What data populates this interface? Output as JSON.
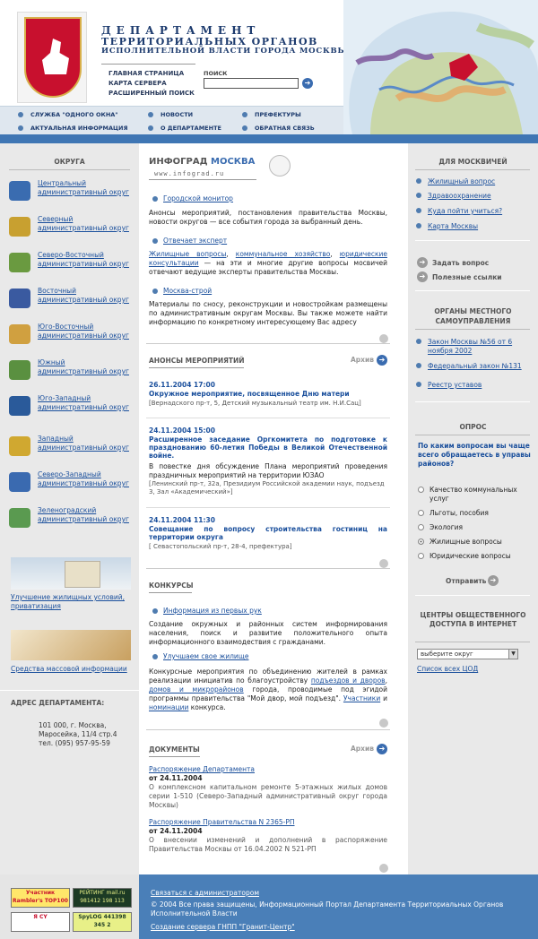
{
  "header": {
    "title_line1": "ДЕПАРТАМЕНТ",
    "title_line2": "ТЕРРИТОРИАЛЬНЫХ  ОРГАНОВ",
    "title_line3": "ИСПОЛНИТЕЛЬНОЙ ВЛАСТИ ГОРОДА МОСКВЫ",
    "links": [
      "ГЛАВНАЯ СТРАНИЦА",
      "КАРТА СЕРВЕРА",
      "РАСШИРЕННЫЙ ПОИСК"
    ],
    "search_label": "ПОИСК",
    "search_value": ""
  },
  "nav": {
    "items": [
      "СЛУЖБА \"ОДНОГО ОКНА\"",
      "НОВОСТИ",
      "ПРЕФЕКТУРЫ",
      "АКТУАЛЬНАЯ ИНФОРМАЦИЯ",
      "О ДЕПАРТАМЕНТЕ",
      "ОБРАТНАЯ СВЯЗЬ"
    ]
  },
  "left": {
    "heading": "ОКРУГА",
    "districts": [
      "Центральный административный округ",
      "Северный административный округ",
      "Северо-Восточный административный округ",
      "Восточный административный округ",
      "Юго-Восточный административный округ",
      "Южный административный округ",
      "Юго-Западный административный округ",
      "Западный административный округ",
      "Северо-Западный административный округ",
      "Зеленоградский административный округ"
    ],
    "promo1": "Улучшение жилищных условий, приватизация",
    "promo2": "Средства массовой информации",
    "address_heading": "АДРЕС ДЕПАРТАМЕНТА:",
    "address": [
      "101 000, г. Москва,",
      "Маросейка, 11/4 стр.4",
      "тел.  (095) 957-95-59"
    ]
  },
  "main": {
    "infograd_brand": "ИНФОГРАД",
    "infograd_city": "МОСКВА",
    "infograd_url": "www.infograd.ru",
    "monitor_link": "Городской монитор",
    "monitor_text": "Анонсы мероприятий, постановления правительства Москвы, новости округов — все события города за выбранный день.",
    "expert_link": "Отвечает эксперт",
    "expert_links": [
      "Жилищные вопросы",
      "коммунальное хозяйство",
      "юридические консультации"
    ],
    "expert_text": " — на эти и многие другие вопросы мосвичей отвечают ведущие эксперты правительства Москвы.",
    "build_link": "Москва-строй",
    "build_text": "Материалы по сносу, реконструкции и новостройкам размещены по административным округам Москвы. Вы также можете найти информацию по конкретному интересующему Вас адресу",
    "events_heading": "АНОНСЫ МЕРОПРИЯТИЙ",
    "archive": "Архив",
    "events": [
      {
        "date": "26.11.2004 17:00",
        "title": "Окружное мероприятие, посвященное Дню матери",
        "desc": "",
        "place": "[Вернадского пр-т, 5, Детский музыкальный театр им. Н.И.Сац]"
      },
      {
        "date": "24.11.2004 15:00",
        "title": "Расширенное заседание Оргкомитета по подготовке к празднованию 60-летия Победы в Великой Отечественной войне.",
        "desc": "В повестке дня обсуждение Плана мероприятий проведения праздничных мероприятий на территории ЮЗАО",
        "place": "[Ленинский пр-т, 32а, Президиум Российской академии наук, подъезд 3, Зал «Академический»]"
      },
      {
        "date": "24.11.2004 11:30",
        "title": "Совещание по вопросу строительства гостиниц на территории округа",
        "desc": "",
        "place": "[ Севастопольский пр-т, 28-4, префектура]"
      }
    ],
    "contests_heading": "КОНКУРСЫ",
    "contest1_link": "Информация из первых рук",
    "contest1_text": "Создание окружных и районных систем информирования населения, поиск и развитие положительного опыта информационного взаимодествия с гражданами.",
    "contest2_link": "Улучшаем свое жилище",
    "contest2_text_a": "Конкурсные мероприятия по объединению жителей в рамках реализации инициатив по благоустройству ",
    "contest2_link_a": "подъездов и дворов",
    "contest2_text_b": ", ",
    "contest2_link_b": "домов и микрорайонов",
    "contest2_text_c": " города, проводимые под эгидой программы правительства \"Мой двор, мой подъезд\". ",
    "contest2_link_c": "Участники",
    "contest2_text_d": " и ",
    "contest2_link_d": "номинации",
    "contest2_text_e": " конкурса.",
    "docs_heading": "ДОКУМЕНТЫ",
    "docs": [
      {
        "title": "Распоряжение Департамента",
        "date": "от 24.11.2004",
        "text": "О комплексном капитальном ремонте 5-этажных жилых домов серии 1-510 (Северо-Западный административный округ города Москвы)"
      },
      {
        "title": "Распоряжение Правительства N 2365-РП",
        "date": "от 24.11.2004",
        "text": "О внесении изменений и дополнений в распоряжение Правительства Москвы от 16.04.2002 N 521-РП"
      }
    ]
  },
  "right": {
    "heading1": "ДЛЯ МОСКВИЧЕЙ",
    "links1": [
      "Жилищный вопрос",
      "Здравоохранение",
      "Куда пойти учиться?",
      "Карта Москвы"
    ],
    "ask": "Задать  вопрос",
    "useful": "Полезные ссылки",
    "heading2": "ОРГАНЫ МЕСТНОГО САМОУПРАВЛЕНИЯ",
    "links2": [
      "Закон Москвы №56 от 6 ноября 2002",
      "Федеральный закон №131",
      "Реестр уставов"
    ],
    "poll_heading": "ОПРОС",
    "poll_question": "По каким вопросам вы чаще всего обращаетесь в управы районов?",
    "poll_options": [
      "Качество коммунальных услуг",
      "Льготы, пособия",
      "Экология",
      "Жилищные вопросы",
      "Юридические вопросы"
    ],
    "poll_selected": 3,
    "send": "Отправить",
    "access_heading": "ЦЕНТРЫ ОБЩЕСТВЕННОГО ДОСТУПА В ИНТЕРНЕТ",
    "select_value": "выберите округ",
    "cod_link": "Список всех ЦОД"
  },
  "footer": {
    "contact": "Связаться с администратором",
    "copyright": "© 2004 Все права защищены, Информационный Портал Департамента Территориальных Органов Исполнительной Власти",
    "created": "Создание сервера ГНПП \"Гранит-Центр\"",
    "badges": [
      "Участник Rambler's TOP100",
      "РЕЙТИНГ mail.ru 981412 198 113",
      "Я CY",
      "SpyLOG 441398 345 2"
    ]
  },
  "colors": {
    "accent": "#1a4f9c",
    "band": "#3f76b4",
    "footer": "#4a7fb8",
    "side": "#e9e9e9"
  }
}
